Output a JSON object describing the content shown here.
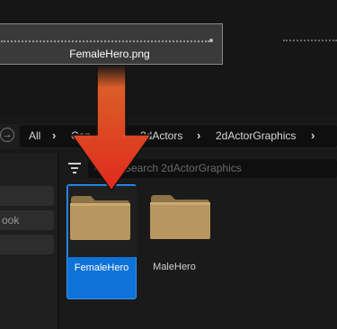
{
  "drag_preview": {
    "filename": "FemaleHero.png"
  },
  "breadcrumb": {
    "items": [
      "All",
      "Con",
      "2dActors",
      "2dActorGraphics"
    ]
  },
  "search": {
    "placeholder": "Search 2dActorGraphics",
    "value": ""
  },
  "sidebar": {
    "items": [
      "",
      "ook",
      ""
    ]
  },
  "assets": [
    {
      "name": "FemaleHero",
      "selected": true
    },
    {
      "name": "MaleHero",
      "selected": false
    }
  ],
  "colors": {
    "selection": "#0f72d8",
    "folder": "#b7965f",
    "arrow_top": "#f26a2a",
    "arrow_bottom": "#e0281d"
  }
}
